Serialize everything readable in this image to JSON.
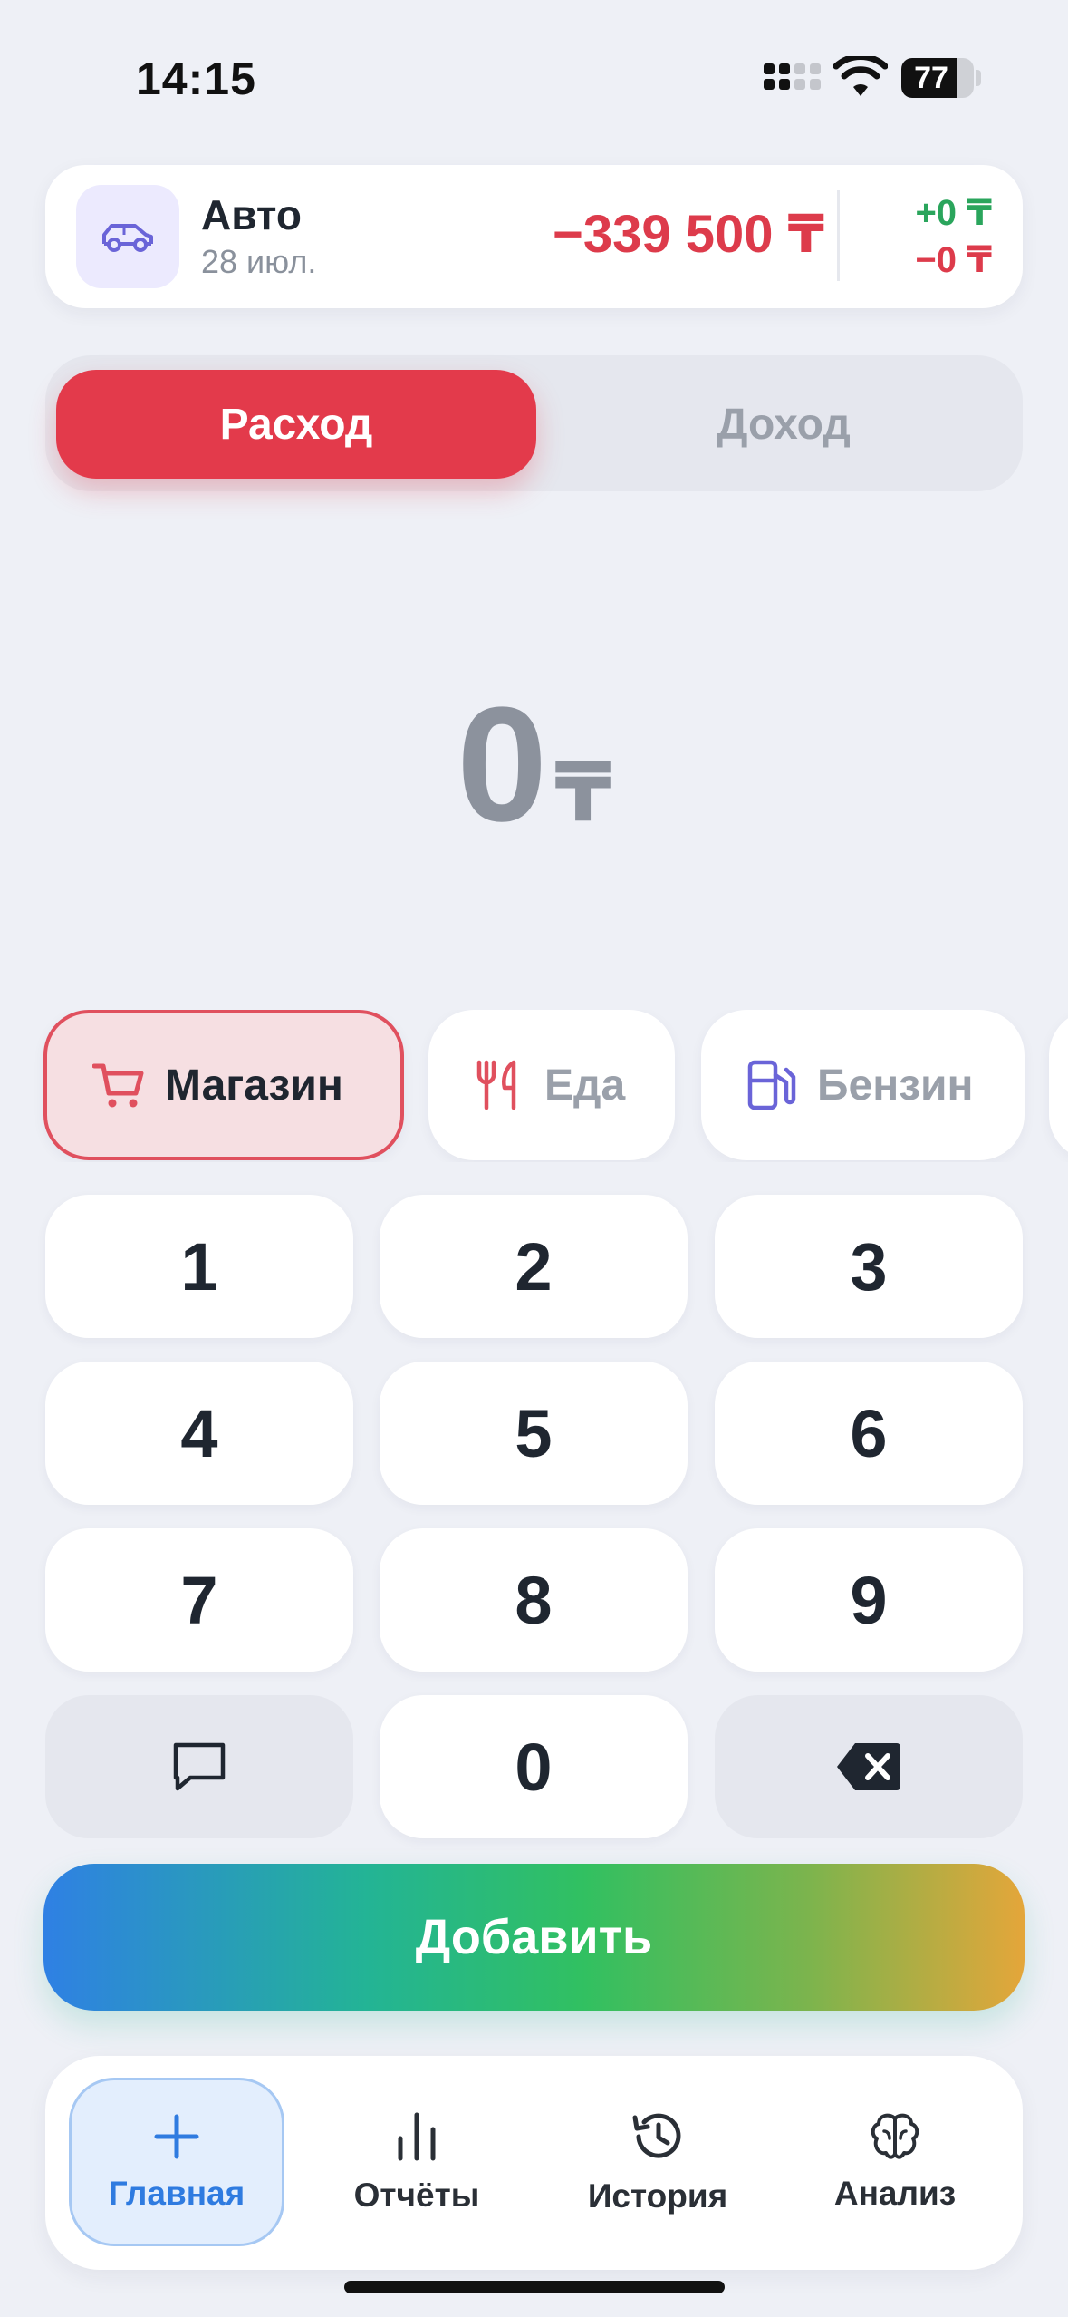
{
  "status_bar": {
    "time": "14:15",
    "battery": "77"
  },
  "account": {
    "icon": "car-icon",
    "name": "Авто",
    "date": "28 июл.",
    "balance": "−339 500 ₸",
    "income_today": "+0 ₸",
    "expense_today": "−0 ₸"
  },
  "segment": {
    "expense_label": "Расход",
    "income_label": "Доход",
    "selected": "expense"
  },
  "amount": {
    "value": "0",
    "currency": "₸"
  },
  "categories": [
    {
      "label": "Магазин",
      "icon": "shopping-cart-icon",
      "selected": true,
      "color": "#e0505e"
    },
    {
      "label": "Еда",
      "icon": "fork-knife-icon",
      "selected": false,
      "color": "#e0505e"
    },
    {
      "label": "Бензин",
      "icon": "fuel-pump-icon",
      "selected": false,
      "color": "#6a64d8"
    }
  ],
  "keypad": {
    "keys": [
      "1",
      "2",
      "3",
      "4",
      "5",
      "6",
      "7",
      "8",
      "9",
      "0"
    ],
    "comment_icon": "comment-icon",
    "backspace_icon": "backspace-icon"
  },
  "add_button": {
    "label": "Добавить"
  },
  "nav": {
    "home": "Главная",
    "reports": "Отчёты",
    "history": "История",
    "analysis": "Анализ"
  },
  "colors": {
    "expense": "#e33a4b",
    "income_positive": "#2aa55c",
    "accent_blue": "#2f7be0"
  }
}
